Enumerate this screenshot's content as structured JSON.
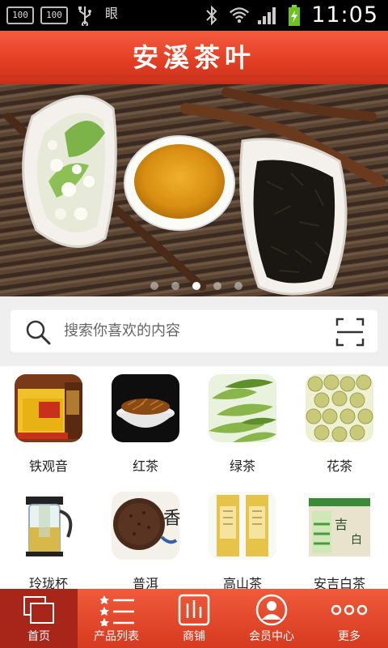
{
  "status_bar": {
    "badge_1": "100",
    "badge_2": "100",
    "badge_3": "眼",
    "time": "11:05"
  },
  "header": {
    "title": "安溪茶叶"
  },
  "banner": {
    "slide_count": 5,
    "active_index": 2
  },
  "search": {
    "placeholder": "搜索你喜欢的内容"
  },
  "categories": [
    {
      "label": "铁观音",
      "icon": "tieguanyin-box-image"
    },
    {
      "label": "红茶",
      "icon": "black-tea-bowl-image"
    },
    {
      "label": "绿茶",
      "icon": "green-tea-leaves-image"
    },
    {
      "label": "花茶",
      "icon": "flower-tea-buds-image"
    },
    {
      "label": "玲珑杯",
      "icon": "glass-teapot-image"
    },
    {
      "label": "普洱",
      "icon": "puer-cake-image"
    },
    {
      "label": "高山茶",
      "icon": "tea-packets-image"
    },
    {
      "label": "安吉白茶",
      "icon": "white-tea-box-image"
    }
  ],
  "nav": [
    {
      "label": "首页",
      "icon": "home-windows-icon"
    },
    {
      "label": "产品列表",
      "icon": "product-list-icon"
    },
    {
      "label": "商铺",
      "icon": "shop-icon"
    },
    {
      "label": "会员中心",
      "icon": "member-icon"
    },
    {
      "label": "更多",
      "icon": "more-dots-icon"
    }
  ],
  "colors": {
    "brand_red": "#e43f24",
    "nav_active": "#a8251a"
  }
}
